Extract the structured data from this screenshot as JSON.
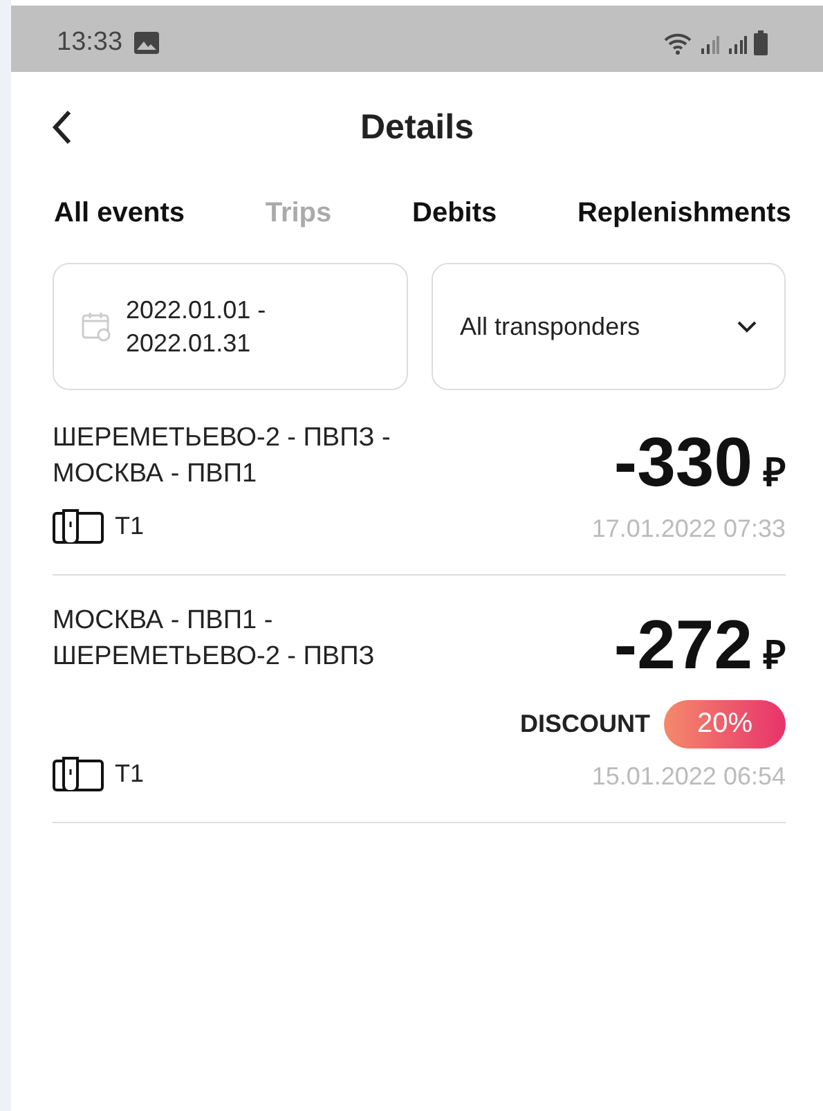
{
  "status_bar": {
    "time": "13:33"
  },
  "header": {
    "title": "Details"
  },
  "tabs": [
    {
      "label": "All events",
      "disabled": false
    },
    {
      "label": "Trips",
      "disabled": true
    },
    {
      "label": "Debits",
      "disabled": false
    },
    {
      "label": "Replenishments",
      "disabled": false
    }
  ],
  "filters": {
    "date_range": "2022.01.01 - 2022.01.31",
    "transponder": "All transponders"
  },
  "events": [
    {
      "route": "ШЕРЕМЕТЬЕВО-2 - ПВПЗ - МОСКВА - ПВП1",
      "transponder": "T1",
      "amount": "-330",
      "currency": "₽",
      "datetime": "17.01.2022 07:33"
    },
    {
      "route": "МОСКВА - ПВП1 - ШЕРЕМЕТЬЕВО-2 - ПВПЗ",
      "transponder": "T1",
      "amount": "-272",
      "currency": "₽",
      "discount_label": "DISCOUNT",
      "discount": "20%",
      "datetime": "15.01.2022 06:54"
    }
  ]
}
